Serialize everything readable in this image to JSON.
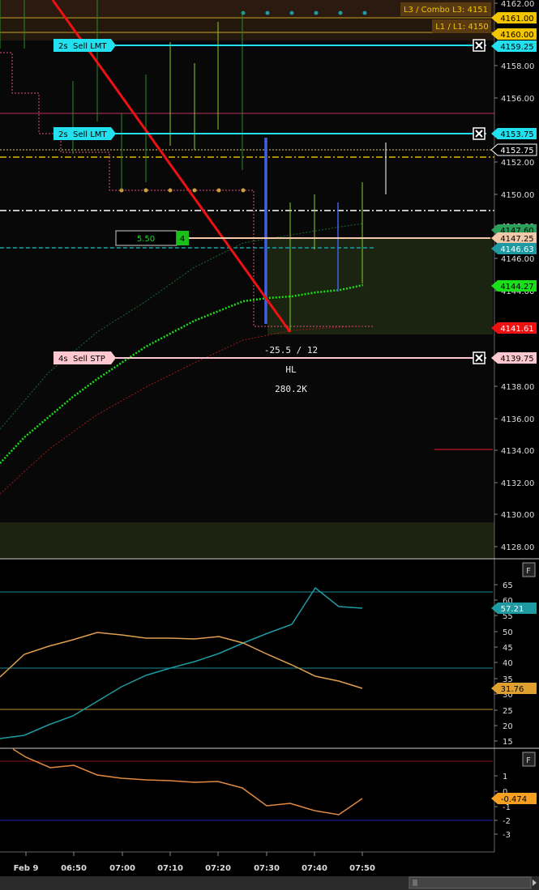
{
  "price_panel": {
    "axis_labels": [
      "4162.00",
      "4158.00",
      "4156.00",
      "4152.00",
      "4150.00",
      "4148.00",
      "4146.00",
      "4144.00",
      "4138.00",
      "4136.00",
      "4134.00",
      "4132.00",
      "4130.00",
      "4128.00"
    ],
    "zone_labels": {
      "l3": "L3 / Combo L3: 4151",
      "l1": "L1 / L1: 4150"
    },
    "price_tags": [
      {
        "id": "p4161",
        "text": "4161.00",
        "bg": "#f2c500",
        "fg": "#000"
      },
      {
        "id": "p4160",
        "text": "4160.00",
        "bg": "#f2c500",
        "fg": "#000"
      },
      {
        "id": "p4159",
        "text": "4159.25",
        "bg": "#22e0ee",
        "fg": "#000"
      },
      {
        "id": "p4153",
        "text": "4153.75",
        "bg": "#22e0ee",
        "fg": "#000"
      },
      {
        "id": "p4152",
        "text": "4152.75",
        "bg": "#000",
        "fg": "#fff"
      },
      {
        "id": "p4147a",
        "text": "4147.60",
        "bg": "#2aa05a",
        "fg": "#000"
      },
      {
        "id": "p4147",
        "text": "4147.25",
        "bg": "#f1c8a8",
        "fg": "#000"
      },
      {
        "id": "p4146",
        "text": "4146.63",
        "bg": "#1e9aa2",
        "fg": "#fff"
      },
      {
        "id": "p4144",
        "text": "4144.27",
        "bg": "#19e019",
        "fg": "#000"
      },
      {
        "id": "p4141",
        "text": "4141.61",
        "bg": "#ee1111",
        "fg": "#fff"
      },
      {
        "id": "p4139",
        "text": "4139.75",
        "bg": "#ffc8d0",
        "fg": "#000"
      }
    ],
    "orders": [
      {
        "qty": "2s",
        "label": "Sell LMT",
        "color": "#22e0ee"
      },
      {
        "qty": "2s",
        "label": "Sell LMT",
        "color": "#22e0ee"
      },
      {
        "qty": "4s",
        "label": "Sell STP",
        "color": "#ffc8d0"
      }
    ],
    "position": {
      "pnl": "5.50",
      "qty": "4"
    },
    "stats": {
      "line1": "-25.5 / 12",
      "line2": "HL",
      "line3": "280.2K"
    }
  },
  "rsi_panel": {
    "axis_labels": [
      "65",
      "60",
      "55",
      "50",
      "45",
      "40",
      "35",
      "30",
      "25",
      "20",
      "15"
    ],
    "tags": [
      {
        "text": "57.21",
        "bg": "#1e9aa2",
        "fg": "#fff"
      },
      {
        "text": "31.76",
        "bg": "#e0a030",
        "fg": "#000"
      }
    ],
    "f_label": "F"
  },
  "osc_panel": {
    "axis_labels": [
      "1",
      "0",
      "-1",
      "-2",
      "-3"
    ],
    "tag": {
      "text": "-0.474",
      "bg": "#f5a020",
      "fg": "#000"
    },
    "f_label": "F"
  },
  "time_axis": [
    "Feb 9",
    "06:50",
    "07:00",
    "07:10",
    "07:20",
    "07:30",
    "07:40",
    "07:50"
  ],
  "colors": {
    "lmt": "#22e0ee",
    "stp": "#ffc8d0",
    "trend": "#ee1111",
    "ema": "#19e019"
  }
}
